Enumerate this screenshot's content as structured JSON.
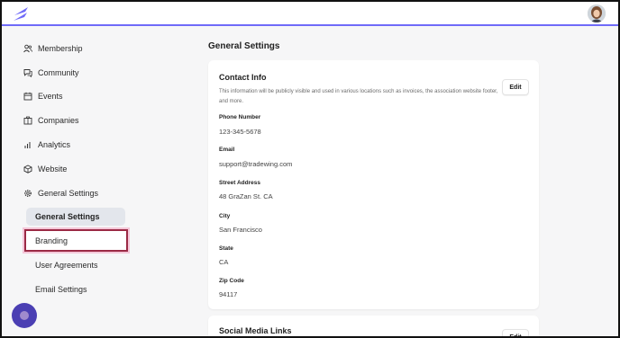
{
  "brand": {
    "accent": "#6f6af8",
    "highlight_border": "#9b2a45",
    "chat_bubble": "#4b3fb3"
  },
  "sidebar": {
    "items": [
      {
        "label": "Membership",
        "icon": "people-icon"
      },
      {
        "label": "Community",
        "icon": "chat-icon"
      },
      {
        "label": "Events",
        "icon": "calendar-icon"
      },
      {
        "label": "Companies",
        "icon": "building-icon"
      },
      {
        "label": "Analytics",
        "icon": "bar-chart-icon"
      },
      {
        "label": "Website",
        "icon": "cube-icon"
      },
      {
        "label": "General Settings",
        "icon": "gear-icon"
      }
    ],
    "sub_items": [
      {
        "label": "General Settings",
        "active": true
      },
      {
        "label": "Branding",
        "highlighted": true
      },
      {
        "label": "User Agreements"
      },
      {
        "label": "Email Settings"
      }
    ]
  },
  "main": {
    "title": "General Settings",
    "contact_card": {
      "title": "Contact Info",
      "description": "This information will be publicly visible and used in various locations such as invoices, the association website footer, and more.",
      "edit_label": "Edit",
      "fields": [
        {
          "label": "Phone Number",
          "value": "123-345-5678"
        },
        {
          "label": "Email",
          "value": "support@tradewing.com"
        },
        {
          "label": "Street Address",
          "value": "48 GraZan St. CA"
        },
        {
          "label": "City",
          "value": "San Francisco"
        },
        {
          "label": "State",
          "value": "CA"
        },
        {
          "label": "Zip Code",
          "value": "94117"
        }
      ]
    },
    "social_card": {
      "title": "Social Media Links",
      "edit_label": "Edit"
    }
  }
}
